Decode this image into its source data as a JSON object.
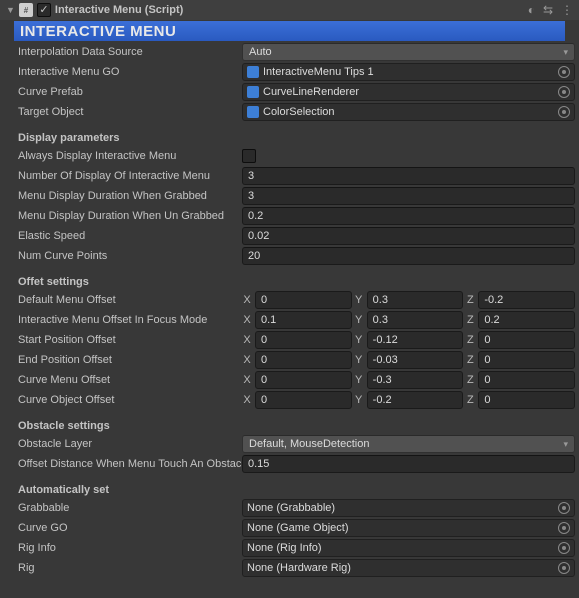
{
  "header": {
    "title": "Interactive Menu (Script)",
    "enabled": true
  },
  "titleBar": "INTERACTIVE MENU",
  "top": {
    "interpolationSource": {
      "label": "Interpolation Data Source",
      "value": "Auto"
    },
    "interactiveMenuGO": {
      "label": "Interactive Menu GO",
      "value": "InteractiveMenu Tips 1"
    },
    "curvePrefab": {
      "label": "Curve Prefab",
      "value": "CurveLineRenderer"
    },
    "targetObject": {
      "label": "Target Object",
      "value": "ColorSelection"
    }
  },
  "display": {
    "header": "Display parameters",
    "always": {
      "label": "Always Display Interactive Menu",
      "checked": false
    },
    "numDisplay": {
      "label": "Number Of Display Of Interactive Menu",
      "value": "3"
    },
    "durGrabbed": {
      "label": "Menu Display Duration When Grabbed",
      "value": "3"
    },
    "durUngrabbed": {
      "label": "Menu Display Duration When Un Grabbed",
      "value": "0.2"
    },
    "elastic": {
      "label": "Elastic Speed",
      "value": "0.02"
    },
    "curvePts": {
      "label": "Num Curve Points",
      "value": "20"
    }
  },
  "offset": {
    "header": "Offet settings",
    "default": {
      "label": "Default Menu Offset",
      "x": "0",
      "y": "0.3",
      "z": "-0.2"
    },
    "focus": {
      "label": "Interactive Menu Offset In Focus Mode",
      "x": "0.1",
      "y": "0.3",
      "z": "0.2"
    },
    "start": {
      "label": "Start Position Offset",
      "x": "0",
      "y": "-0.12",
      "z": "0"
    },
    "end": {
      "label": "End Position Offset",
      "x": "0",
      "y": "-0.03",
      "z": "0"
    },
    "curveMenu": {
      "label": "Curve Menu Offset",
      "x": "0",
      "y": "-0.3",
      "z": "0"
    },
    "curveObj": {
      "label": "Curve Object Offset",
      "x": "0",
      "y": "-0.2",
      "z": "0"
    }
  },
  "obstacle": {
    "header": "Obstacle settings",
    "layer": {
      "label": "Obstacle Layer",
      "value": "Default, MouseDetection"
    },
    "offsetDist": {
      "label": "Offset Distance When Menu Touch An Obstacle",
      "value": "0.15"
    }
  },
  "auto": {
    "header": "Automatically set",
    "grabbable": {
      "label": "Grabbable",
      "value": "None (Grabbable)"
    },
    "curveGO": {
      "label": "Curve GO",
      "value": "None (Game Object)"
    },
    "rigInfo": {
      "label": "Rig Info",
      "value": "None (Rig Info)"
    },
    "rig": {
      "label": "Rig",
      "value": "None (Hardware Rig)"
    }
  },
  "axes": {
    "x": "X",
    "y": "Y",
    "z": "Z"
  }
}
